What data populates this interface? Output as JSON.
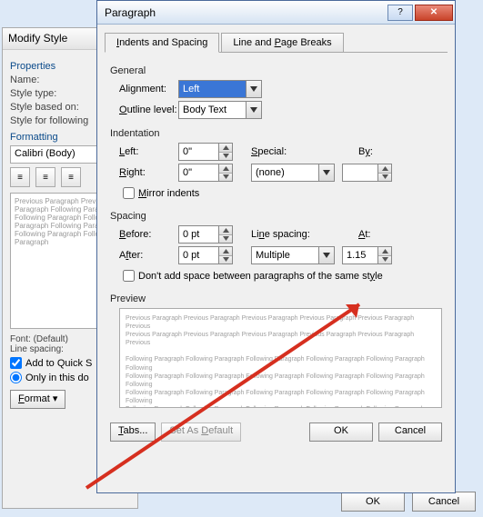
{
  "parent": {
    "ok": "OK",
    "cancel": "Cancel"
  },
  "modify": {
    "title": "Modify Style",
    "props": "Properties",
    "name": "Name:",
    "styletype": "Style type:",
    "basedon": "Style based on:",
    "following": "Style for following",
    "formatting": "Formatting",
    "font": "Calibri (Body)",
    "previewtxt": "Previous Paragraph Previous Paragraph Following Paragraph Following Paragraph Following Paragraph Following Paragraph Following Paragraph Following Paragraph",
    "desc1": "Font: (Default)",
    "desc2": "Line spacing:",
    "addquick": "Add to Quick S",
    "onlydoc": "Only in this do",
    "formatbtn_u": "F",
    "formatbtn_r": "ormat ▾"
  },
  "dlg": {
    "title": "Paragraph",
    "tab1": {
      "u": "I",
      "r": "ndents and Spacing"
    },
    "tab2": {
      "a": "Line and ",
      "u": "P",
      "b": "age Breaks"
    },
    "general": "General",
    "align": {
      "a": "Ali",
      "u": "g",
      "b": "nment:",
      "val": "Left"
    },
    "outline": {
      "u": "O",
      "r": "utline level:",
      "val": "Body Text"
    },
    "indent": "Indentation",
    "left": {
      "u": "L",
      "r": "eft:",
      "val": "0\""
    },
    "right": {
      "u": "R",
      "r": "ight:",
      "val": "0\""
    },
    "special": {
      "u": "S",
      "r": "pecial:",
      "val": "(none)"
    },
    "by": {
      "a": "B",
      "u": "y",
      "b": ":",
      "val": ""
    },
    "mirror": {
      "u": "M",
      "r": "irror indents"
    },
    "spacing": "Spacing",
    "before": {
      "u": "B",
      "r": "efore:",
      "val": "0 pt"
    },
    "after": {
      "a": "A",
      "u": "f",
      "b": "ter:",
      "val": "0 pt"
    },
    "linesp": {
      "a": "Li",
      "u": "n",
      "b": "e spacing:",
      "val": "Multiple"
    },
    "at": {
      "u": "A",
      "r": "t:",
      "val": "1.15"
    },
    "noadd": {
      "a": "Don't add space between paragraphs of the same st",
      "u": "y",
      "b": "le"
    },
    "preview": "Preview",
    "prevtxt1": "Previous Paragraph Previous Paragraph Previous Paragraph Previous Paragraph Previous Paragraph Previous",
    "prevtxt2": "Following Paragraph Following Paragraph Following Paragraph Following Paragraph Following Paragraph Following",
    "tabs": {
      "u": "T",
      "r": "abs..."
    },
    "setdef": {
      "a": "Set As ",
      "u": "D",
      "b": "efault"
    },
    "ok": "OK",
    "cancel": "Cancel"
  }
}
